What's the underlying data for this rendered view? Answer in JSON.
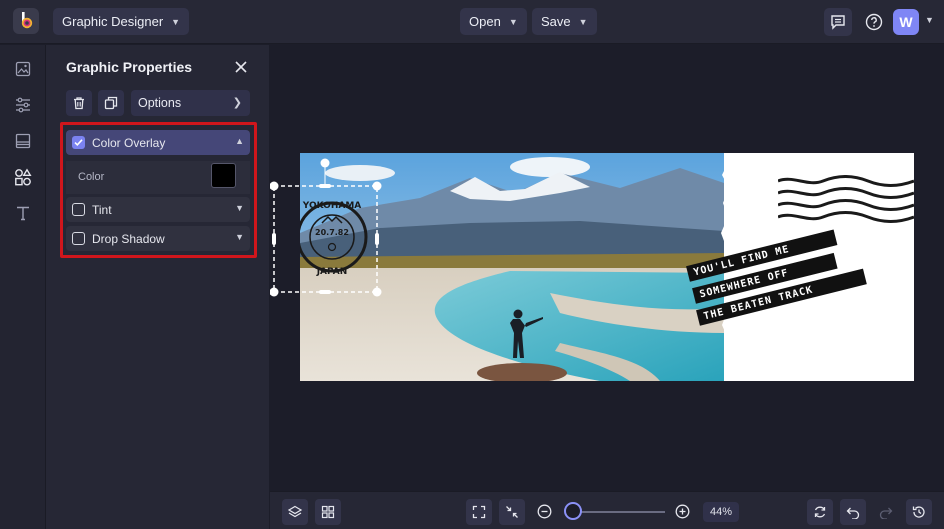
{
  "app": {
    "mode_label": "Graphic Designer",
    "open_label": "Open",
    "save_label": "Save",
    "avatar_initial": "W",
    "accent_color": "#7b82f1"
  },
  "panel": {
    "title": "Graphic Properties",
    "options_label": "Options",
    "sections": [
      {
        "label": "Color Overlay",
        "checked": true,
        "expanded": true
      },
      {
        "label": "Tint",
        "checked": false,
        "expanded": false
      },
      {
        "label": "Drop Shadow",
        "checked": false,
        "expanded": false
      }
    ],
    "color_label": "Color",
    "color_value": "#000000",
    "highlight_color": "#d0161c"
  },
  "rail": {
    "icons": [
      "image-icon",
      "sliders-icon",
      "layout-icon",
      "shapes-icon",
      "text-icon"
    ]
  },
  "canvas": {
    "stamp_top": "YOKOHAMA",
    "stamp_date": "20.7.82",
    "stamp_bottom": "JAPAN",
    "banner_lines": [
      "YOU'LL FIND ME",
      "SOMEWHERE OFF",
      "THE BEATEN TRACK"
    ]
  },
  "bottom": {
    "zoom_label": "44%",
    "zoom_value": 0.44
  }
}
